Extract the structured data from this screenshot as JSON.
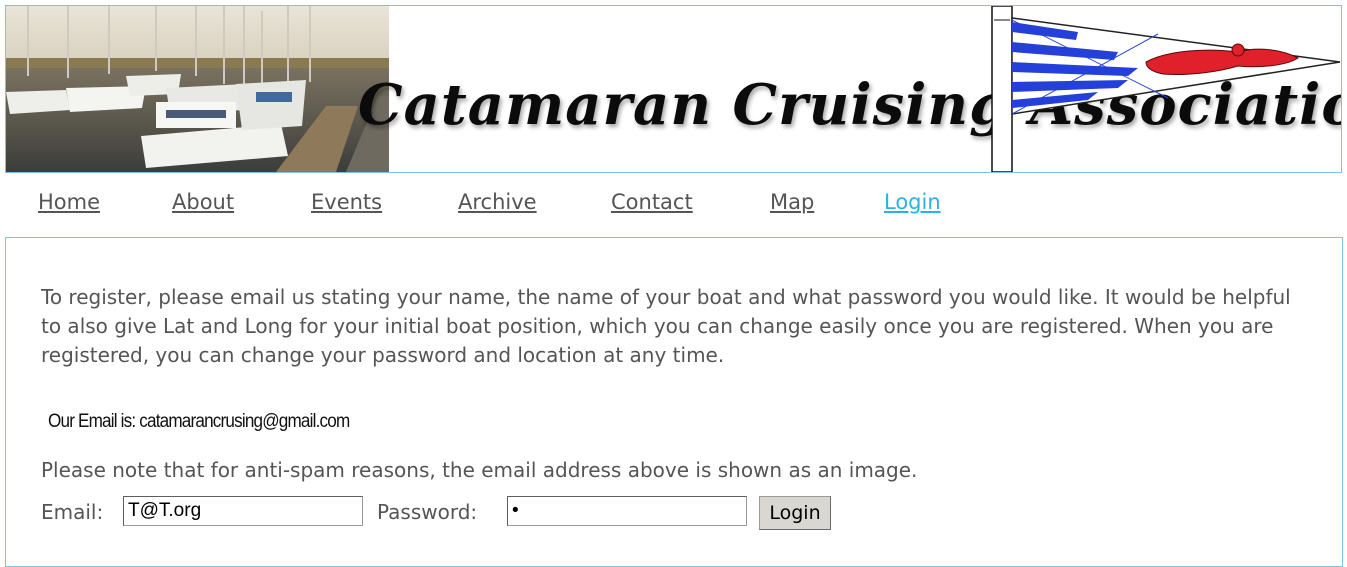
{
  "header": {
    "title": "Catamaran Cruising Association",
    "photo_icon": "marina-photo",
    "flag_icon": "association-burgee-flag"
  },
  "nav": {
    "items": [
      "Home",
      "About",
      "Events",
      "Archive",
      "Contact",
      "Map",
      "Login"
    ],
    "active": "Login"
  },
  "content": {
    "intro": "To register, please email us stating your name, the name of your boat and what password you would like. It would be helpful to also give Lat and Long for your initial boat position, which you can change easily once you are registered. When you are registered, you can change your password and location at any time.",
    "email_image_text": "Our Email is:  catamarancrusing@gmail.com",
    "note": "Please note that for anti-spam reasons, the email address above is shown as an image."
  },
  "login_form": {
    "email_label": "Email:",
    "email_value": "T@T.org",
    "password_label": "Password:",
    "password_value": "x",
    "submit_label": "Login"
  },
  "colors": {
    "border": "#7cc3e6",
    "active_link": "#29b2e8",
    "text": "#555555"
  }
}
